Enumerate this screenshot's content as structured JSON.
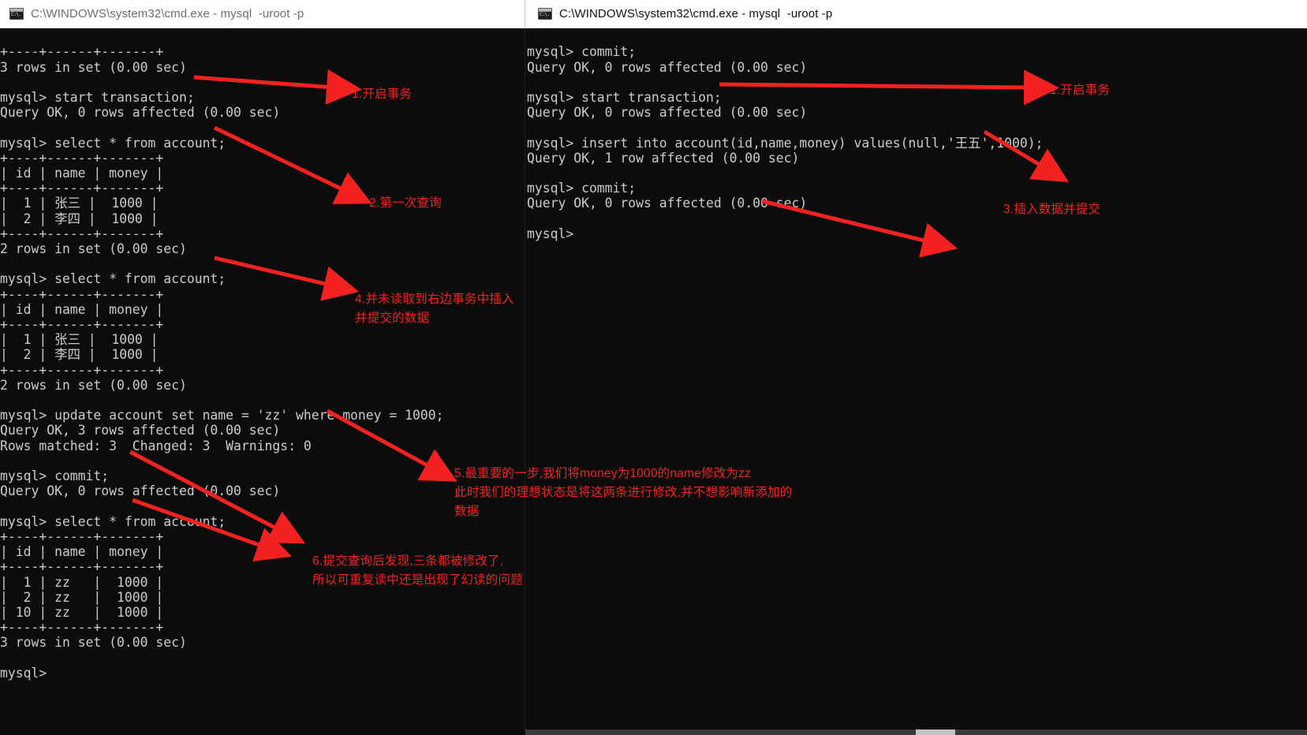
{
  "windows": {
    "left": {
      "title": "C:\\WINDOWS\\system32\\cmd.exe - mysql  -uroot -p",
      "icon": "cmd-icon",
      "focused": false,
      "console_text": "+----+------+-------+\n3 rows in set (0.00 sec)\n\nmysql> start transaction;\nQuery OK, 0 rows affected (0.00 sec)\n\nmysql> select * from account;\n+----+------+-------+\n| id | name | money |\n+----+------+-------+\n|  1 | 张三 |  1000 |\n|  2 | 李四 |  1000 |\n+----+------+-------+\n2 rows in set (0.00 sec)\n\nmysql> select * from account;\n+----+------+-------+\n| id | name | money |\n+----+------+-------+\n|  1 | 张三 |  1000 |\n|  2 | 李四 |  1000 |\n+----+------+-------+\n2 rows in set (0.00 sec)\n\nmysql> update account set name = 'zz' where money = 1000;\nQuery OK, 3 rows affected (0.00 sec)\nRows matched: 3  Changed: 3  Warnings: 0\n\nmysql> commit;\nQuery OK, 0 rows affected (0.00 sec)\n\nmysql> select * from account;\n+----+------+-------+\n| id | name | money |\n+----+------+-------+\n|  1 | zz   |  1000 |\n|  2 | zz   |  1000 |\n| 10 | zz   |  1000 |\n+----+------+-------+\n3 rows in set (0.00 sec)\n\nmysql>"
    },
    "right": {
      "title": "C:\\WINDOWS\\system32\\cmd.exe - mysql  -uroot -p",
      "icon": "cmd-icon",
      "focused": true,
      "console_text": "mysql> commit;\nQuery OK, 0 rows affected (0.00 sec)\n\nmysql> start transaction;\nQuery OK, 0 rows affected (0.00 sec)\n\nmysql> insert into account(id,name,money) values(null,'王五',1000);\nQuery OK, 1 row affected (0.00 sec)\n\nmysql> commit;\nQuery OK, 0 rows affected (0.00 sec)\n\nmysql>"
    }
  },
  "annotations": {
    "color": "#f42121",
    "items": [
      {
        "id": "a1",
        "text": "1.开启事务"
      },
      {
        "id": "a2",
        "text": "2.第一次查询"
      },
      {
        "id": "a4",
        "text": "4.并未读取到右边事务中插入\n并提交的数据"
      },
      {
        "id": "a5",
        "text": "5.最重要的一步,我们将money为1000的name修改为zz\n此时我们的理想状态是将这两条进行修改,并不想影响新添加的\n数据"
      },
      {
        "id": "a6",
        "text": "6.提交查询后发现,三条都被修改了,\n所以可重复读中还是出现了幻读的问题"
      },
      {
        "id": "r1",
        "text": "1.开启事务"
      },
      {
        "id": "r3",
        "text": "3.插入数据并提交"
      }
    ]
  },
  "scrollbar": {
    "orientation": "horizontal"
  }
}
